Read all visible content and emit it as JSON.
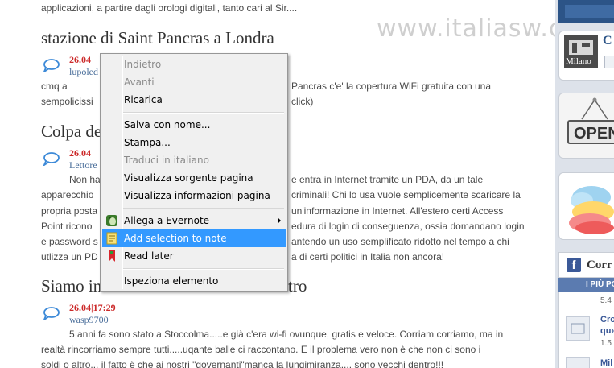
{
  "watermark": "www.italiasw.com",
  "blog": {
    "top_line": "applicazioni, a partire dagli orologi digitali, tanto cari al Sir....",
    "post1": {
      "title": "stazione di Saint Pancras a Londra",
      "date": "26.04",
      "author": "lupoled",
      "line1_left": "cmq a",
      "line1_right": "Pancras c'e' la copertura WiFi gratuita con una",
      "line2_left": "sempolicissi",
      "line2_right": "i click)"
    },
    "post2": {
      "title": "Colpa de",
      "date": "26.04",
      "author": "Lettore",
      "lines": [
        {
          "left": "Non ha",
          "right": "e entra in Internet tramite un PDA, da un tale"
        },
        {
          "left": "apparecchio",
          "right": "criminali! Chi lo usa vuole semplicemente scaricare la"
        },
        {
          "left": "propria posta",
          "right": "un'informazione in Internet. All'estero certi Access"
        },
        {
          "left": "Point ricono",
          "right": "edura di login di conseguenza, ossia domandano login"
        },
        {
          "left": "e password s",
          "right": "antendo un uso semplificato ridotto nel tempo a chi"
        },
        {
          "left": "utlizza un PD",
          "right": "a di certi politici in Italia non ancora!"
        }
      ]
    },
    "post3": {
      "title_left": "Siamo in",
      "title_right": "tro",
      "date": "26.04|17:29",
      "author": "wasp9700",
      "lines": [
        "5 anni fa sono stato a Stoccolma.....e già c'era wi-fi ovunque, gratis e veloce. Corriam corriamo, ma in",
        "realtà rincorriamo sempre tutti.....uqante balle ci raccontano. E il problema vero non è che non ci sono i",
        "soldi o altro... il fatto è che ai nostri \"governanti\"manca la lungimiranza.... sono vecchi dentro!!!"
      ]
    }
  },
  "sidebar": {
    "milano_label": "Milano",
    "milano_heading": "C",
    "open_sign": "OPEN",
    "facebook": {
      "title": "Corr",
      "subbar": "I PIÙ PO",
      "rows": [
        {
          "meta": "5.4"
        },
        {
          "link": "Cro",
          "link2": "que",
          "meta": "1.5"
        },
        {
          "link": "Mil"
        }
      ]
    }
  },
  "context_menu": {
    "items": [
      {
        "label": "Indietro",
        "disabled": true
      },
      {
        "label": "Avanti",
        "disabled": true
      },
      {
        "label": "Ricarica",
        "disabled": false
      },
      {
        "label": "Salva con nome...",
        "disabled": false
      },
      {
        "label": "Stampa...",
        "disabled": false
      },
      {
        "label": "Traduci in italiano",
        "disabled": true
      },
      {
        "label": "Visualizza sorgente pagina",
        "disabled": false
      },
      {
        "label": "Visualizza informazioni pagina",
        "disabled": false
      },
      {
        "label": "Allega a Evernote",
        "disabled": false,
        "icon": "evernote-icon",
        "submenu": true
      },
      {
        "label": "Add selection to note",
        "disabled": false,
        "icon": "note-icon",
        "highlighted": true
      },
      {
        "label": "Read later",
        "disabled": false,
        "icon": "bookmark-icon"
      },
      {
        "label": "Ispeziona elemento",
        "disabled": false
      }
    ]
  },
  "colors": {
    "highlight": "#3399ff",
    "date_red": "#cc2a2a",
    "author_blue": "#4a6e9a",
    "sidebar_blue": "#2c5487",
    "facebook_blue": "#3b5998"
  }
}
